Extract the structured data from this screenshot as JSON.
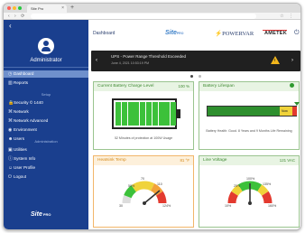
{
  "browser": {
    "tab_title": "Site Pro",
    "tab_close": "×",
    "new_tab": "+",
    "nav_glyphs": "‹ › ⟳",
    "url": "",
    "right_glyphs": "☆ ⋮"
  },
  "sidebar": {
    "collapse_glyph": "‹",
    "username": "Administrator",
    "items_top": [
      {
        "icon": "gauge-icon",
        "glyph": "◷",
        "label": "Dashboard"
      },
      {
        "icon": "chart-icon",
        "glyph": "▥",
        "label": "Reports"
      }
    ],
    "section_setup": "Setup",
    "items_setup": [
      {
        "icon": "lock-icon",
        "glyph": "🔒",
        "label": "Security © 1440"
      },
      {
        "icon": "network-icon",
        "glyph": "⌘",
        "label": "Network"
      },
      {
        "icon": "network-advanced-icon",
        "glyph": "⌘",
        "label": "Network Advanced"
      },
      {
        "icon": "environment-icon",
        "glyph": "◉",
        "label": "Environment"
      },
      {
        "icon": "users-icon",
        "glyph": "☻",
        "label": "Users"
      }
    ],
    "section_admin": "Administration",
    "items_admin": [
      {
        "icon": "utilities-icon",
        "glyph": "▣",
        "label": "Utilities"
      },
      {
        "icon": "info-icon",
        "glyph": "ⓘ",
        "label": "System Info"
      },
      {
        "icon": "user-profile-icon",
        "glyph": "☺",
        "label": "User Profile"
      },
      {
        "icon": "logout-icon",
        "glyph": "⏻",
        "label": "Logout"
      }
    ],
    "logo_text": "Site",
    "logo_sub": "PRO"
  },
  "header": {
    "title": "Dashboard",
    "logo_site": "Site",
    "logo_site_sub": "PRO",
    "logo_powervar": "POWERVAR",
    "logo_ametek": "AMETEK",
    "power_glyph": "⏻"
  },
  "alert": {
    "prev_glyph": "‹",
    "next_glyph": "›",
    "title": "UPS - Power Range Threshold Exceeded",
    "time": "June 4, 2021 10:53:19 PM",
    "warn_glyph": "!",
    "pages": 2,
    "active_page": 0
  },
  "cards": {
    "battery_charge": {
      "title": "Current Battery Charge Level",
      "status": "100 %",
      "footer": "52 Minutes of protection at 100W Usage",
      "charge_fraction": 1.0,
      "cells": 10,
      "color": "#3cc13a"
    },
    "battery_lifespan": {
      "title": "Battery Lifespan",
      "bar_label": "Now",
      "footer": "Battery Health: Good. 8 Years and 9 Months Life Remaining",
      "status_color": "#2e9a2e"
    },
    "heatsink": {
      "title": "Heatsink Temp",
      "status": "81 °F",
      "ticks": [
        "30",
        "50%",
        "70",
        "110",
        "124%"
      ],
      "value_fraction": 0.78
    },
    "line_voltage": {
      "title": "Line Voltage",
      "status": "121 VAC",
      "ticks": [
        "10%",
        "25%",
        "100%",
        "135%",
        "160%"
      ],
      "value_fraction": 0.5
    }
  },
  "colors": {
    "sidebar": "#1a3f8e",
    "active_nav": "#6f90cc",
    "green": "#3cc13a",
    "orange": "#f2a23a",
    "red": "#e33a2f",
    "yellow": "#f0d33a"
  }
}
